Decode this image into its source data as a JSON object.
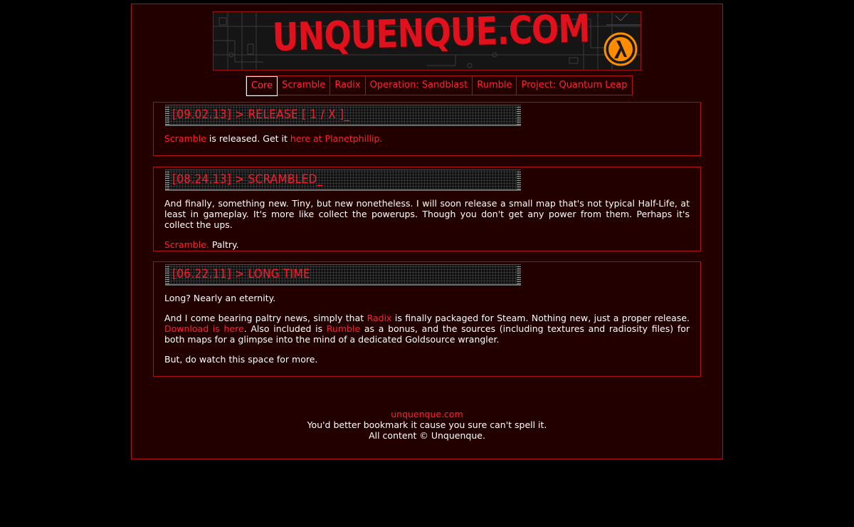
{
  "banner": {
    "title": "UNQUENQUE.COM",
    "logo_icon": "half-life-lambda-icon"
  },
  "nav": {
    "items": [
      {
        "label": "Core",
        "active": true
      },
      {
        "label": "Scramble"
      },
      {
        "label": "Radix"
      },
      {
        "label": "Operation: Sandblast"
      },
      {
        "label": "Rumble"
      },
      {
        "label": "Project: Quantum Leap"
      }
    ]
  },
  "posts": [
    {
      "title": "[09.02.13] > RELEASE [ 1 / X ]_",
      "p1_link1": "Scramble",
      "p1_text1": " is released. Get it ",
      "p1_link2": "here at Planetphillip."
    },
    {
      "title": "[08.24.13] > SCRAMBLED_",
      "p1_text": "And finally, something new. Tiny, but new nonetheless. I will soon release a small map that's not typical Half-Life, at least in gameplay. It's more like collect the powerups. Though you don't get any power from them. Perhaps it's collect the ups.",
      "p2_link": "Scramble.",
      "p2_text": " Paltry."
    },
    {
      "title": "[06.22.11] > LONG TIME",
      "p1_text": "Long? Nearly an eternity.",
      "p2_text1": "And I come bearing paltry news, simply that ",
      "p2_link1": "Radix",
      "p2_text2": " is finally packaged for Steam. Nothing new, just a proper release. ",
      "p2_link2": "Download is here",
      "p2_text3": ". Also included is ",
      "p2_link3": "Rumble",
      "p2_text4": " as a bonus, and the sources (including textures and radiosity files) for both maps for a glimpse into the mind of a dedicated Goldsource wrangler.",
      "p3_text": "But, do watch this space for more."
    }
  ],
  "footer": {
    "site_link": "unquenque.com",
    "line2": "You'd better bookmark it cause you sure can't spell it.",
    "line3": "All content © Unquenque."
  },
  "colors": {
    "accent": "#ff2233",
    "page_bg": "#230000",
    "border": "#b01010"
  }
}
